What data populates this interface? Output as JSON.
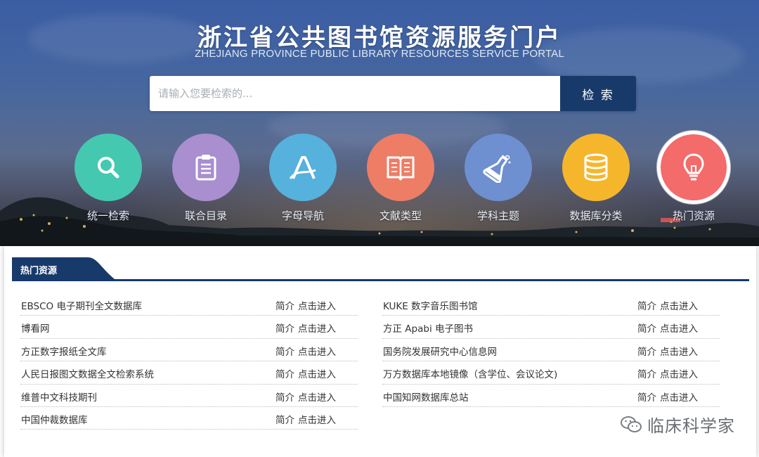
{
  "header": {
    "title": "浙江省公共图书馆资源服务门户",
    "subtitle": "ZHEJIANG PROVINCE PUBLIC LIBRARY RESOURCES SERVICE PORTAL"
  },
  "search": {
    "placeholder": "请输入您要检索的...",
    "value": "",
    "button_label": "检 索"
  },
  "nav": [
    {
      "label": "统一检索",
      "icon": "search-icon",
      "color": "#45c8b0"
    },
    {
      "label": "联合目录",
      "icon": "clipboard-list-icon",
      "color": "#a98ed0"
    },
    {
      "label": "字母导航",
      "icon": "letter-a-icon",
      "color": "#56b1dc"
    },
    {
      "label": "文献类型",
      "icon": "open-book-icon",
      "color": "#ee7d66"
    },
    {
      "label": "学科主题",
      "icon": "flask-icon",
      "color": "#6e8fd0"
    },
    {
      "label": "数据库分类",
      "icon": "database-icon",
      "color": "#f6b62c"
    },
    {
      "label": "热门资源",
      "icon": "lightbulb-icon",
      "color": "#f36b6b",
      "active": true
    }
  ],
  "panel": {
    "title": "热门资源",
    "tab_color": "#183a6b",
    "intro_label": "简介",
    "enter_label": "点击进入",
    "left": [
      {
        "name": "EBSCO 电子期刊全文数据库"
      },
      {
        "name": "博看网"
      },
      {
        "name": "方正数字报纸全文库"
      },
      {
        "name": "人民日报图文数据全文检索系统"
      },
      {
        "name": "维普中文科技期刊"
      },
      {
        "name": "中国仲裁数据库"
      }
    ],
    "right": [
      {
        "name": "KUKE 数字音乐图书馆"
      },
      {
        "name": "方正 Apabi 电子图书"
      },
      {
        "name": "国务院发展研究中心信息网"
      },
      {
        "name": "万方数据库本地镜像（含学位、会议论文)"
      },
      {
        "name": "中国知网数据库总站"
      }
    ]
  },
  "watermark": {
    "text": "临床科学家",
    "icon": "wechat-icon"
  }
}
